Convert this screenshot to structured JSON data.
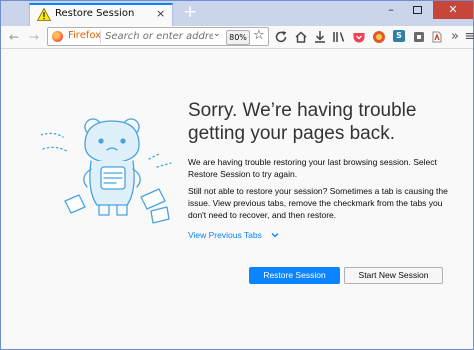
{
  "tab": {
    "title": "Restore Session",
    "close_glyph": "×"
  },
  "new_tab_glyph": "+",
  "window_controls": {
    "minimize": "–",
    "close": "✕"
  },
  "nav": {
    "back": "←",
    "forward": "→",
    "reload": "⟳",
    "home": "⌂"
  },
  "urlbar": {
    "identity_label": "Firefox",
    "placeholder": "Search or enter address",
    "dropdown_glyph": "⌄",
    "zoom": "80%",
    "bookmark_glyph": "☆"
  },
  "extensions": [
    {
      "name": "s-extension",
      "label": "S",
      "color": "#2f7fa6"
    }
  ],
  "page": {
    "title": "Sorry. We’re having trouble getting your pages back.",
    "para1": "We are having trouble restoring your last browsing session. Select Restore Session to try again.",
    "para2": "Still not able to restore your session? Sometimes a tab is causing the issue. View previous tabs, remove the checkmark from the tabs you don't need to recover, and then restore.",
    "view_previous_tabs": "View Previous Tabs",
    "restore_button": "Restore Session",
    "new_session_button": "Start New Session"
  },
  "colors": {
    "accent": "#0a84ff",
    "tab_strip": "#cad5ec",
    "close": "#c7453b"
  }
}
